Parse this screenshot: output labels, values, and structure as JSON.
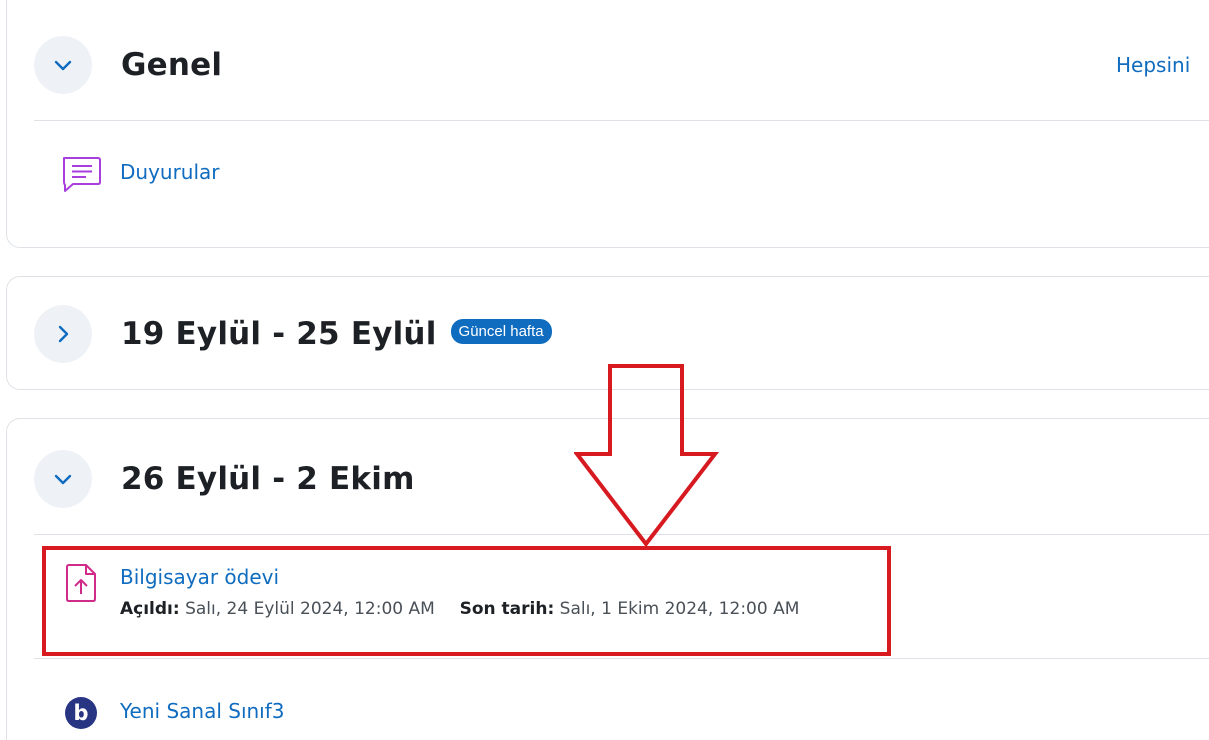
{
  "sections": {
    "genel": {
      "title": "Genel",
      "collapse_all_label": "Hepsini",
      "activities": [
        {
          "name": "Duyurular",
          "icon": "forum-icon"
        }
      ]
    },
    "week1": {
      "title": "19 Eylül - 25 Eylül",
      "badge": "Güncel hafta"
    },
    "week2": {
      "title": "26 Eylül - 2 Ekim",
      "activities": [
        {
          "name": "Bilgisayar ödevi",
          "icon": "assignment-upload-icon",
          "opened_label": "Açıldı:",
          "opened_value": "Salı, 24 Eylül 2024, 12:00 AM",
          "due_label": "Son tarih:",
          "due_value": "Salı, 1 Ekim 2024, 12:00 AM"
        },
        {
          "name": "Yeni Sanal Sınıf3",
          "icon": "bigbluebutton-icon"
        }
      ]
    }
  },
  "colors": {
    "link": "#0f6cbf",
    "badge": "#0f6cbf",
    "highlight": "#d71920",
    "forum_icon": "#a83edc",
    "assignment_icon": "#d12b8a",
    "bbb_icon": "#283583"
  }
}
